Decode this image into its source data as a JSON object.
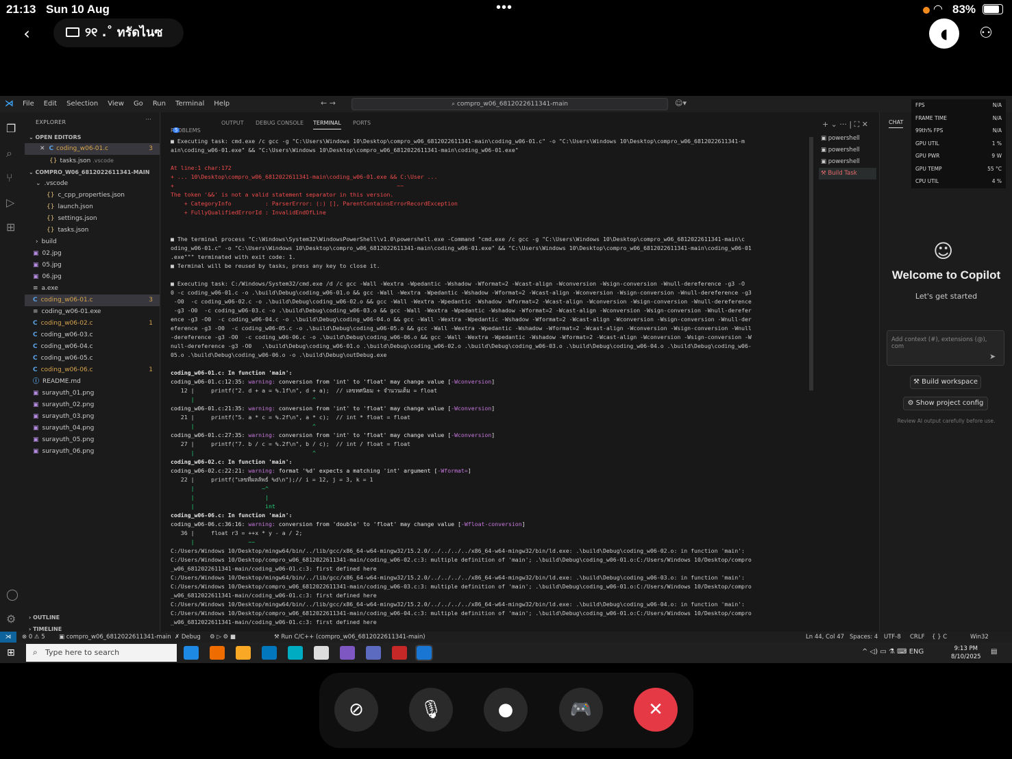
{
  "ios": {
    "time": "21:13",
    "date": "Sun 10 Aug",
    "dots": "•••",
    "battery": "83%"
  },
  "session": {
    "title": "୨୧ .˚ ทรัดไนซ"
  },
  "vscode": {
    "menu": [
      "File",
      "Edit",
      "Selection",
      "View",
      "Go",
      "Run",
      "Terminal",
      "Help"
    ],
    "search": "compro_w06_6812022611341-main",
    "explorer": {
      "title": "EXPLORER",
      "open_editors": "OPEN EDITORS",
      "open1": "coding_w06-01.c",
      "open1_count": "3",
      "open2": "tasks.json",
      "open2_dir": ".vscode",
      "project": "COMPRO_W06_6812022611341-MAIN",
      "files": [
        {
          "name": ".vscode",
          "kind": "folder"
        },
        {
          "name": "c_cpp_properties.json",
          "kind": "json"
        },
        {
          "name": "launch.json",
          "kind": "json"
        },
        {
          "name": "settings.json",
          "kind": "json"
        },
        {
          "name": "tasks.json",
          "kind": "json"
        },
        {
          "name": "build",
          "kind": "folder"
        },
        {
          "name": "02.jpg",
          "kind": "img"
        },
        {
          "name": "05.jpg",
          "kind": "img"
        },
        {
          "name": "06.jpg",
          "kind": "img"
        },
        {
          "name": "a.exe",
          "kind": "exe"
        },
        {
          "name": "coding_w06-01.c",
          "kind": "c",
          "count": "3"
        },
        {
          "name": "coding_w06-01.exe",
          "kind": "exe"
        },
        {
          "name": "coding_w06-02.c",
          "kind": "c",
          "count": "1"
        },
        {
          "name": "coding_w06-03.c",
          "kind": "c"
        },
        {
          "name": "coding_w06-04.c",
          "kind": "c"
        },
        {
          "name": "coding_w06-05.c",
          "kind": "c"
        },
        {
          "name": "coding_w06-06.c",
          "kind": "c",
          "count": "1"
        },
        {
          "name": "README.md",
          "kind": "md"
        },
        {
          "name": "surayuth_01.png",
          "kind": "img"
        },
        {
          "name": "surayuth_02.png",
          "kind": "img"
        },
        {
          "name": "surayuth_03.png",
          "kind": "img"
        },
        {
          "name": "surayuth_04.png",
          "kind": "img"
        },
        {
          "name": "surayuth_05.png",
          "kind": "img"
        },
        {
          "name": "surayuth_06.png",
          "kind": "img"
        }
      ],
      "outline": "OUTLINE",
      "timeline": "TIMELINE"
    },
    "panel_tabs": {
      "problems": "PROBLEMS",
      "problems_count": "5",
      "output": "OUTPUT",
      "debug": "DEBUG CONSOLE",
      "terminal": "TERMINAL",
      "ports": "PORTS"
    },
    "terminals": [
      "powershell",
      "powershell",
      "powershell",
      "Build Task"
    ],
    "terminal_lines": [
      {
        "t": "■ Executing task: cmd.exe /c gcc -g \"C:\\Users\\Windows 10\\Desktop\\compro_w06_6812022611341-main\\coding_w06-01.c\" -o \"C:\\Users\\Windows 10\\Desktop\\compro_w06_6812022611341-m",
        "c": ""
      },
      {
        "t": "ain\\coding_w06-01.exe\" && \"C:\\Users\\Windows 10\\Desktop\\compro_w06_6812022611341-main\\coding_w06-01.exe\"",
        "c": ""
      },
      {
        "t": "",
        "c": ""
      },
      {
        "t": "At line:1 char:172",
        "c": "red"
      },
      {
        "t": "+ ... 10\\Desktop\\compro_w06_6812022611341-main\\coding_w06-01.exe && C:\\User ...",
        "c": "red"
      },
      {
        "t": "+                                                                  ~~",
        "c": "red"
      },
      {
        "t": "The token '&&' is not a valid statement separator in this version.",
        "c": "red"
      },
      {
        "t": "    + CategoryInfo          : ParserError: (:) [], ParentContainsErrorRecordException",
        "c": "red"
      },
      {
        "t": "    + FullyQualifiedErrorId : InvalidEndOfLine",
        "c": "red"
      },
      {
        "t": "",
        "c": ""
      },
      {
        "t": "",
        "c": ""
      },
      {
        "t": "■ The terminal process \"C:\\Windows\\System32\\WindowsPowerShell\\v1.0\\powershell.exe -Command \"cmd.exe /c gcc -g \"C:\\Users\\Windows 10\\Desktop\\compro_w06_6812022611341-main\\c",
        "c": ""
      },
      {
        "t": "oding_w06-01.c\" -o \"C:\\Users\\Windows 10\\Desktop\\compro_w06_6812022611341-main\\coding_w06-01.exe\" && \"C:\\Users\\Windows 10\\Desktop\\compro_w06_6812022611341-main\\coding_w06-01",
        "c": ""
      },
      {
        "t": ".exe\"\"\" terminated with exit code: 1.",
        "c": ""
      },
      {
        "t": "■ Terminal will be reused by tasks, press any key to close it.",
        "c": ""
      },
      {
        "t": "",
        "c": ""
      },
      {
        "t": "■ Executing task: C:/Windows/System32/cmd.exe /d /c gcc -Wall -Wextra -Wpedantic -Wshadow -Wformat=2 -Wcast-align -Wconversion -Wsign-conversion -Wnull-dereference -g3 -O",
        "c": ""
      },
      {
        "t": "0 -c coding_w06-01.c -o .\\build\\Debug\\coding_w06-01.o && gcc -Wall -Wextra -Wpedantic -Wshadow -Wformat=2 -Wcast-align -Wconversion -Wsign-conversion -Wnull-dereference -g3",
        "c": ""
      },
      {
        "t": " -O0  -c coding_w06-02.c -o .\\build\\Debug\\coding_w06-02.o && gcc -Wall -Wextra -Wpedantic -Wshadow -Wformat=2 -Wcast-align -Wconversion -Wsign-conversion -Wnull-dereference",
        "c": ""
      },
      {
        "t": " -g3 -O0  -c coding_w06-03.c -o .\\build\\Debug\\coding_w06-03.o && gcc -Wall -Wextra -Wpedantic -Wshadow -Wformat=2 -Wcast-align -Wconversion -Wsign-conversion -Wnull-derefer",
        "c": ""
      },
      {
        "t": "ence -g3 -O0  -c coding_w06-04.c -o .\\build\\Debug\\coding_w06-04.o && gcc -Wall -Wextra -Wpedantic -Wshadow -Wformat=2 -Wcast-align -Wconversion -Wsign-conversion -Wnull-der",
        "c": ""
      },
      {
        "t": "eference -g3 -O0  -c coding_w06-05.c -o .\\build\\Debug\\coding_w06-05.o && gcc -Wall -Wextra -Wpedantic -Wshadow -Wformat=2 -Wcast-align -Wconversion -Wsign-conversion -Wnull",
        "c": ""
      },
      {
        "t": "-dereference -g3 -O0  -c coding_w06-06.c -o .\\build\\Debug\\coding_w06-06.o && gcc -Wall -Wextra -Wpedantic -Wshadow -Wformat=2 -Wcast-align -Wconversion -Wsign-conversion -W",
        "c": ""
      },
      {
        "t": "null-dereference -g3 -O0   .\\build\\Debug\\coding_w06-01.o .\\build\\Debug\\coding_w06-02.o .\\build\\Debug\\coding_w06-03.o .\\build\\Debug\\coding_w06-04.o .\\build\\Debug\\coding_w06-",
        "c": ""
      },
      {
        "t": "05.o .\\build\\Debug\\coding_w06-06.o -o .\\build\\Debug\\outDebug.exe",
        "c": ""
      },
      {
        "t": "",
        "c": ""
      },
      {
        "t": "coding_w06-01.c: In function 'main':",
        "c": "bold"
      },
      {
        "t": "coding_w06-01.c:12:35: warning: conversion from 'int' to 'float' may change value [-Wconversion]",
        "c": "warn"
      },
      {
        "t": "   12 |     printf(\"2. d + a = %.1f\\n\", d + a);  // เลขทศนิยม + จำนวนเต็ม = float",
        "c": ""
      },
      {
        "t": "      |                                   ^",
        "c": "grn"
      },
      {
        "t": "coding_w06-01.c:21:35: warning: conversion from 'int' to 'float' may change value [-Wconversion]",
        "c": "warn"
      },
      {
        "t": "   21 |     printf(\"5. a * c = %.2f\\n\", a * c);  // int * float = float",
        "c": ""
      },
      {
        "t": "      |                                   ^",
        "c": "grn"
      },
      {
        "t": "coding_w06-01.c:27:35: warning: conversion from 'int' to 'float' may change value [-Wconversion]",
        "c": "warn"
      },
      {
        "t": "   27 |     printf(\"7. b / c = %.2f\\n\", b / c);  // int / float = float",
        "c": ""
      },
      {
        "t": "      |                                   ^",
        "c": "grn"
      },
      {
        "t": "coding_w06-02.c: In function 'main':",
        "c": "bold"
      },
      {
        "t": "coding_w06-02.c:22:21: warning: format '%d' expects a matching 'int' argument [-Wformat=]",
        "c": "warn"
      },
      {
        "t": "   22 |     printf(\"เลขที่ผลลัพธ์ %d\\n\");// i = 12, j = 3, k = 1",
        "c": ""
      },
      {
        "t": "      |                    ~^",
        "c": "grn"
      },
      {
        "t": "      |                     |",
        "c": "grn"
      },
      {
        "t": "      |                     int",
        "c": "grn"
      },
      {
        "t": "coding_w06-06.c: In function 'main':",
        "c": "bold"
      },
      {
        "t": "coding_w06-06.c:36:16: warning: conversion from 'double' to 'float' may change value [-Wfloat-conversion]",
        "c": "warn"
      },
      {
        "t": "   36 |     float r3 = ++x * y - a / 2;",
        "c": ""
      },
      {
        "t": "      |                ~~",
        "c": "grn"
      },
      {
        "t": "C:/Users/Windows 10/Desktop/mingw64/bin/../lib/gcc/x86_64-w64-mingw32/15.2.0/../../../../x86_64-w64-mingw32/bin/ld.exe: .\\build\\Debug\\coding_w06-02.o: in function 'main':",
        "c": ""
      },
      {
        "t": "C:/Users/Windows 10/Desktop/compro_w06_6812022611341-main/coding_w06-02.c:3: multiple definition of 'main'; .\\build\\Debug\\coding_w06-01.o:C:/Users/Windows 10/Desktop/compro",
        "c": ""
      },
      {
        "t": "_w06_6812022611341-main/coding_w06-01.c:3: first defined here",
        "c": ""
      },
      {
        "t": "C:/Users/Windows 10/Desktop/mingw64/bin/../lib/gcc/x86_64-w64-mingw32/15.2.0/../../../../x86_64-w64-mingw32/bin/ld.exe: .\\build\\Debug\\coding_w06-03.o: in function 'main':",
        "c": ""
      },
      {
        "t": "C:/Users/Windows 10/Desktop/compro_w06_6812022611341-main/coding_w06-03.c:3: multiple definition of 'main'; .\\build\\Debug\\coding_w06-01.o:C:/Users/Windows 10/Desktop/compro",
        "c": ""
      },
      {
        "t": "_w06_6812022611341-main/coding_w06-01.c:3: first defined here",
        "c": ""
      },
      {
        "t": "C:/Users/Windows 10/Desktop/mingw64/bin/../lib/gcc/x86_64-w64-mingw32/15.2.0/../../../../x86_64-w64-mingw32/bin/ld.exe: .\\build\\Debug\\coding_w06-04.o: in function 'main':",
        "c": ""
      },
      {
        "t": "C:/Users/Windows 10/Desktop/compro_w06_6812022611341-main/coding_w06-04.c:3: multiple definition of 'main'; .\\build\\Debug\\coding_w06-01.o:C:/Users/Windows 10/Desktop/compro",
        "c": ""
      },
      {
        "t": "_w06_6812022611341-main/coding_w06-01.c:3: first defined here",
        "c": ""
      }
    ],
    "chat": {
      "tab": "CHAT",
      "welcome": "Welcome to Copilot",
      "sub": "Let's get started",
      "placeholder": "Add context (#), extensions (@), com",
      "build": "Build workspace",
      "config": "Show project config",
      "review": "Review AI output carefully before use."
    },
    "overlay": [
      {
        "k": "FPS",
        "v": "N/A"
      },
      {
        "k": "FRAME TIME",
        "v": "N/A"
      },
      {
        "k": "99th% FPS",
        "v": "N/A"
      },
      {
        "k": "GPU UTIL",
        "v": "1 %"
      },
      {
        "k": "GPU PWR",
        "v": "9 W"
      },
      {
        "k": "GPU TEMP",
        "v": "55 °C"
      },
      {
        "k": "CPU UTIL",
        "v": "4 %"
      }
    ],
    "statusbar": {
      "problems": "⊗ 0 ⚠ 5",
      "folder": "compro_w06_6812022611341-main",
      "debug": "Debug",
      "run": "Run C/C++ (compro_w06_6812022611341-main)",
      "pos": "Ln 44, Col 47",
      "spaces": "Spaces: 4",
      "enc": "UTF-8",
      "eol": "CRLF",
      "lang": "{ } C",
      "platform": "Win32"
    }
  },
  "taskbar": {
    "search": "Type here to search",
    "lang": "ENG",
    "time": "9:13 PM",
    "date": "8/10/2025"
  },
  "colors": {
    "accent": "#3ba0ef",
    "end_call": "#e63946",
    "warn": "#c678dd",
    "error": "#f14c4c"
  }
}
